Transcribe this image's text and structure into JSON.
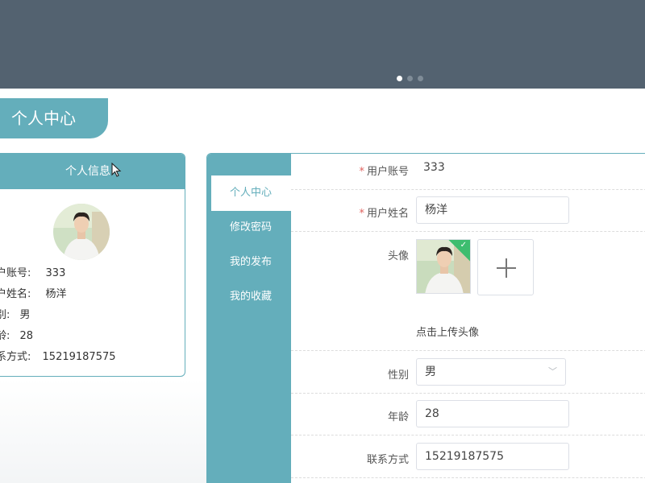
{
  "banner": {
    "dots": [
      true,
      false,
      false
    ]
  },
  "page_title": "个人中心",
  "info_card": {
    "title": "个人信息",
    "rows": [
      {
        "label": "户账号:",
        "value": "333"
      },
      {
        "label": "户姓名:",
        "value": "杨洋"
      },
      {
        "label": "别:",
        "value": "男"
      },
      {
        "label": "龄:",
        "value": "28"
      },
      {
        "label": "系方式:",
        "value": "15219187575"
      }
    ]
  },
  "side_nav": {
    "items": [
      {
        "label": "个人中心",
        "active": true
      },
      {
        "label": "修改密码",
        "active": false
      },
      {
        "label": "我的发布",
        "active": false
      },
      {
        "label": "我的收藏",
        "active": false
      }
    ]
  },
  "form": {
    "account": {
      "required_mark": "*",
      "label": "用户账号",
      "value": "333"
    },
    "name": {
      "required_mark": "*",
      "label": "用户姓名",
      "value": "杨洋"
    },
    "avatar": {
      "label": "头像",
      "hint": "点击上传头像"
    },
    "gender": {
      "label": "性别",
      "value": "男"
    },
    "age": {
      "label": "年龄",
      "value": "28"
    },
    "contact": {
      "label": "联系方式",
      "value": "15219187575"
    }
  },
  "colors": {
    "accent": "#64aebb",
    "banner": "#536270",
    "required": "#e0625e",
    "success": "#3dbd6f"
  }
}
